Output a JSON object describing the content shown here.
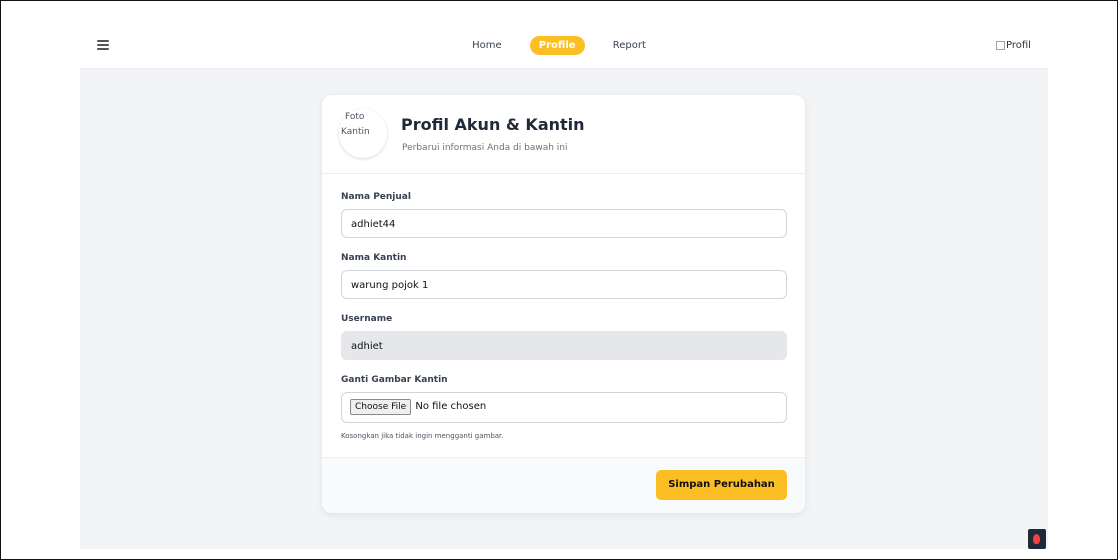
{
  "nav": {
    "items": [
      {
        "label": "Home"
      },
      {
        "label": "Profile",
        "active": true
      },
      {
        "label": "Report"
      }
    ],
    "avatar_alt": "Profil"
  },
  "card": {
    "photo_alt_line1": "Foto",
    "photo_alt_line2": "Kantin",
    "title": "Profil Akun & Kantin",
    "subtitle": "Perbarui informasi Anda di bawah ini"
  },
  "form": {
    "seller_name_label": "Nama Penjual",
    "seller_name_value": "adhiet44",
    "canteen_name_label": "Nama Kantin",
    "canteen_name_value": "warung pojok 1",
    "username_label": "Username",
    "username_value": "adhiet",
    "image_label": "Ganti Gambar Kantin",
    "file_button_label": "Choose File",
    "file_status": "No file chosen",
    "hint": "Kosongkan jika tidak ingin mengganti gambar."
  },
  "footer": {
    "save_label": "Simpan Perubahan"
  },
  "colors": {
    "accent": "#fbbf24",
    "background": "#f3f4f6"
  }
}
